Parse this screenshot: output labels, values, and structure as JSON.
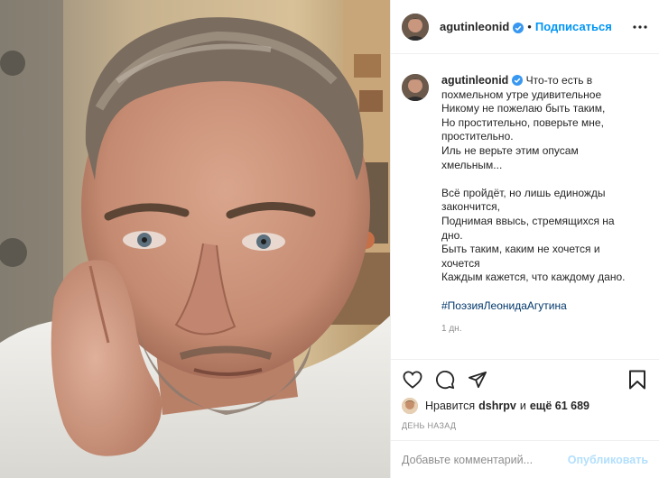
{
  "post": {
    "author": {
      "username": "agutinleonid",
      "verified": true
    },
    "header": {
      "separator": "•",
      "follow_label": "Подписаться",
      "more_icon": "more-horizontal-icon"
    },
    "caption": {
      "lines": [
        "Что-то есть в",
        "похмельном утре удивительное",
        "Никому не пожелаю быть таким,",
        "Но простительно, поверьте мне,",
        "простительно.",
        "Иль не верьте этим опусам",
        "хмельным...",
        "",
        "Всё пройдёт, но лишь единожды",
        "закончится,",
        "Поднимая ввысь, стремящихся на",
        "дно.",
        "Быть таким, каким не хочется и",
        "хочется",
        "Каждым кажется, что каждому дано."
      ],
      "hashtag": "#ПоэзияЛеонидаАгутина",
      "time": "1 дн."
    },
    "actions": {
      "like_icon": "heart-icon",
      "comment_icon": "comment-icon",
      "share_icon": "paper-plane-icon",
      "save_icon": "bookmark-icon"
    },
    "likes": {
      "prefix": "Нравится",
      "user": "dshrpv",
      "connector": "и",
      "others": "ещё 61 689"
    },
    "date_label": "ДЕНЬ НАЗАД",
    "comment_box": {
      "placeholder": "Добавьте комментарий...",
      "publish_label": "Опубликовать"
    }
  },
  "colors": {
    "link_blue": "#0095f6",
    "hashtag_blue": "#00376b",
    "muted_gray": "#8e8e8e",
    "publish_disabled": "#b2dffc",
    "verified_blue": "#3897f0"
  }
}
